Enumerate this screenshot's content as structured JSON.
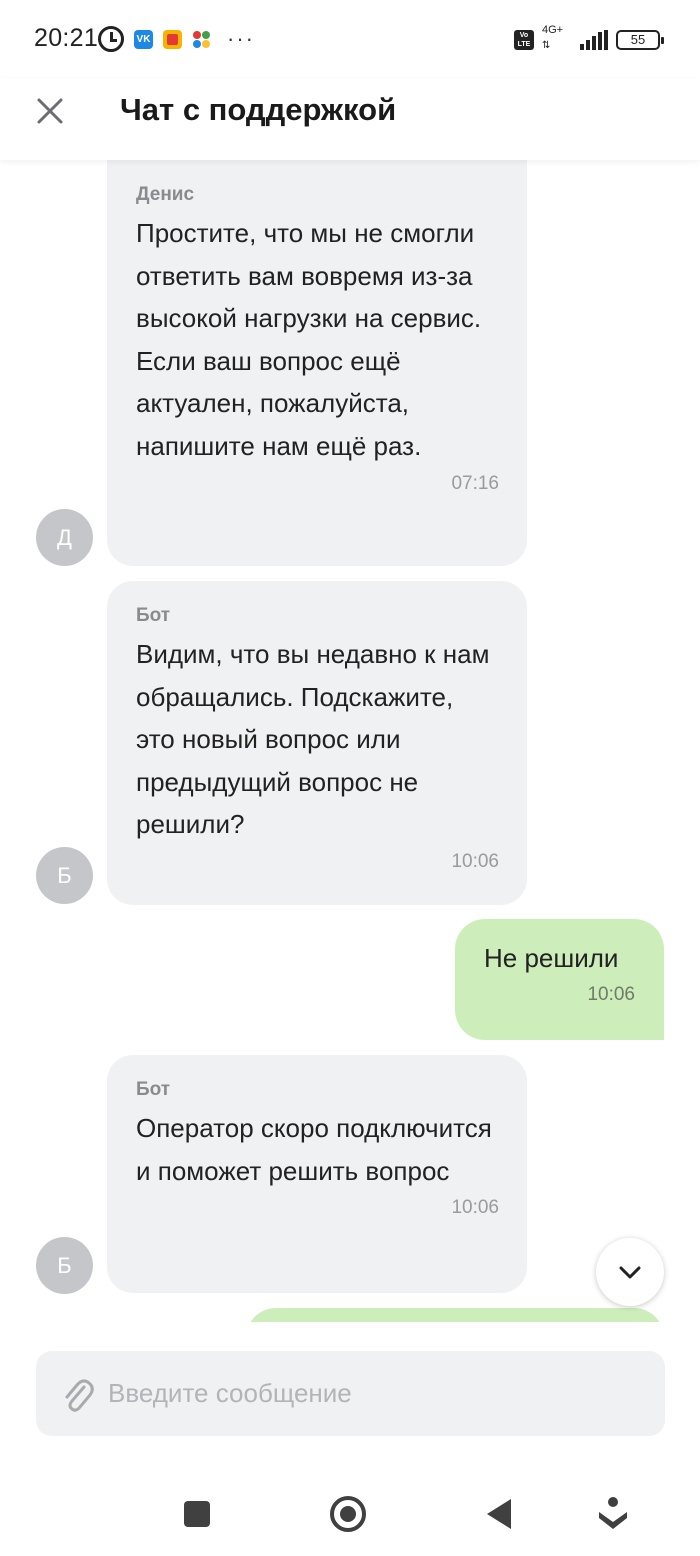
{
  "status_bar": {
    "time": "20:21",
    "vk_label": "VK",
    "network": "4G+",
    "volte": "Vo LTE",
    "battery": "55"
  },
  "header": {
    "title": "Чат с поддержкой"
  },
  "messages": [
    {
      "direction": "in",
      "sender": "Денис",
      "avatar": "Д",
      "text": "Простите, что мы не смогли ответить вам вовремя из-за высокой нагрузки на сервис. Если ваш вопрос ещё актуален, пожалуйста, напишите нам ещё раз.",
      "time": "07:16"
    },
    {
      "direction": "in",
      "sender": "Бот",
      "avatar": "Б",
      "text": "Видим, что вы недавно к нам обращались. Подскажите, это новый вопрос или предыдущий вопрос не решили?",
      "time": "10:06"
    },
    {
      "direction": "out",
      "text": "Не решили",
      "time": "10:06"
    },
    {
      "direction": "in",
      "sender": "Бот",
      "avatar": "Б",
      "text": "Оператор скоро подключится и поможет решить вопрос",
      "time": "10:06"
    }
  ],
  "composer": {
    "placeholder": "Введите сообщение",
    "value": ""
  },
  "colors": {
    "incoming_bubble": "#f0f1f3",
    "outgoing_bubble": "#cdeebb",
    "avatar": "#c5c6ca"
  }
}
